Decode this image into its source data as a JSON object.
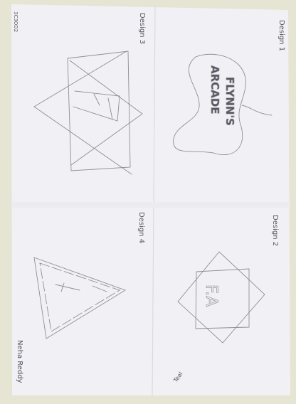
{
  "sheet": {
    "code": "3C3OD2",
    "author": "Neha Reddy",
    "note": "Teal"
  },
  "designs": [
    {
      "label": "Design 1",
      "logo_line1": "FLYNN'S",
      "logo_line2": "ARCADE"
    },
    {
      "label": "Design 2",
      "logo_text": "F.A"
    },
    {
      "label": "Design 3"
    },
    {
      "label": "Design 4"
    }
  ]
}
